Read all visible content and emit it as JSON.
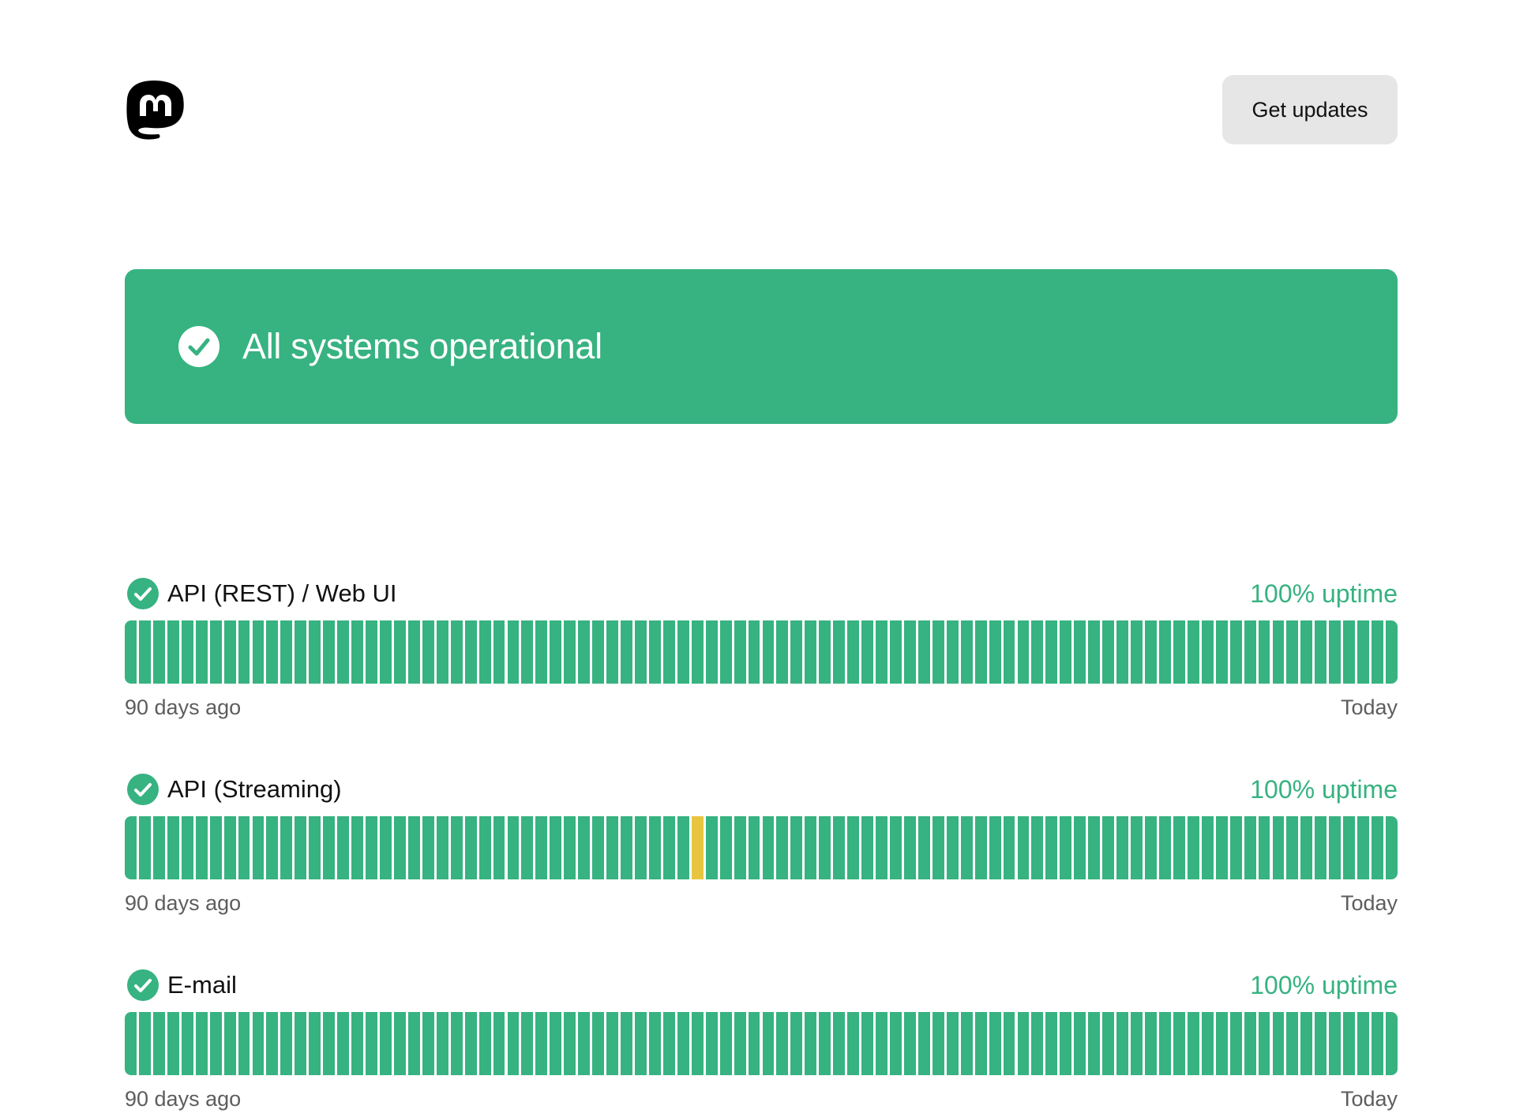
{
  "header": {
    "logo_icon": "mastodon-logo-icon",
    "get_updates_label": "Get updates"
  },
  "banner": {
    "icon": "check-circle-icon",
    "title": "All systems operational",
    "color": "#37b281"
  },
  "components": [
    {
      "name": "API (REST) / Web UI",
      "uptime": "100% uptime",
      "status_icon": "check-circle-icon",
      "start_label": "90 days ago",
      "end_label": "Today",
      "days": [
        "up",
        "up",
        "up",
        "up",
        "up",
        "up",
        "up",
        "up",
        "up",
        "up",
        "up",
        "up",
        "up",
        "up",
        "up",
        "up",
        "up",
        "up",
        "up",
        "up",
        "up",
        "up",
        "up",
        "up",
        "up",
        "up",
        "up",
        "up",
        "up",
        "up",
        "up",
        "up",
        "up",
        "up",
        "up",
        "up",
        "up",
        "up",
        "up",
        "up",
        "up",
        "up",
        "up",
        "up",
        "up",
        "up",
        "up",
        "up",
        "up",
        "up",
        "up",
        "up",
        "up",
        "up",
        "up",
        "up",
        "up",
        "up",
        "up",
        "up",
        "up",
        "up",
        "up",
        "up",
        "up",
        "up",
        "up",
        "up",
        "up",
        "up",
        "up",
        "up",
        "up",
        "up",
        "up",
        "up",
        "up",
        "up",
        "up",
        "up",
        "up",
        "up",
        "up",
        "up",
        "up",
        "up",
        "up",
        "up",
        "up",
        "up"
      ]
    },
    {
      "name": "API (Streaming)",
      "uptime": "100% uptime",
      "status_icon": "check-circle-icon",
      "start_label": "90 days ago",
      "end_label": "Today",
      "days": [
        "up",
        "up",
        "up",
        "up",
        "up",
        "up",
        "up",
        "up",
        "up",
        "up",
        "up",
        "up",
        "up",
        "up",
        "up",
        "up",
        "up",
        "up",
        "up",
        "up",
        "up",
        "up",
        "up",
        "up",
        "up",
        "up",
        "up",
        "up",
        "up",
        "up",
        "up",
        "up",
        "up",
        "up",
        "up",
        "up",
        "up",
        "up",
        "up",
        "up",
        "partial",
        "up",
        "up",
        "up",
        "up",
        "up",
        "up",
        "up",
        "up",
        "up",
        "up",
        "up",
        "up",
        "up",
        "up",
        "up",
        "up",
        "up",
        "up",
        "up",
        "up",
        "up",
        "up",
        "up",
        "up",
        "up",
        "up",
        "up",
        "up",
        "up",
        "up",
        "up",
        "up",
        "up",
        "up",
        "up",
        "up",
        "up",
        "up",
        "up",
        "up",
        "up",
        "up",
        "up",
        "up",
        "up",
        "up",
        "up",
        "up",
        "up"
      ]
    },
    {
      "name": "E-mail",
      "uptime": "100% uptime",
      "status_icon": "check-circle-icon",
      "start_label": "90 days ago",
      "end_label": "Today",
      "days": [
        "up",
        "up",
        "up",
        "up",
        "up",
        "up",
        "up",
        "up",
        "up",
        "up",
        "up",
        "up",
        "up",
        "up",
        "up",
        "up",
        "up",
        "up",
        "up",
        "up",
        "up",
        "up",
        "up",
        "up",
        "up",
        "up",
        "up",
        "up",
        "up",
        "up",
        "up",
        "up",
        "up",
        "up",
        "up",
        "up",
        "up",
        "up",
        "up",
        "up",
        "up",
        "up",
        "up",
        "up",
        "up",
        "up",
        "up",
        "up",
        "up",
        "up",
        "up",
        "up",
        "up",
        "up",
        "up",
        "up",
        "up",
        "up",
        "up",
        "up",
        "up",
        "up",
        "up",
        "up",
        "up",
        "up",
        "up",
        "up",
        "up",
        "up",
        "up",
        "up",
        "up",
        "up",
        "up",
        "up",
        "up",
        "up",
        "up",
        "up",
        "up",
        "up",
        "up",
        "up",
        "up",
        "up",
        "up",
        "up",
        "up",
        "up"
      ]
    }
  ],
  "colors": {
    "up": "#37b281",
    "partial": "#e8c540",
    "button_bg": "#e6e6e6",
    "muted_text": "#5d5d5d"
  }
}
